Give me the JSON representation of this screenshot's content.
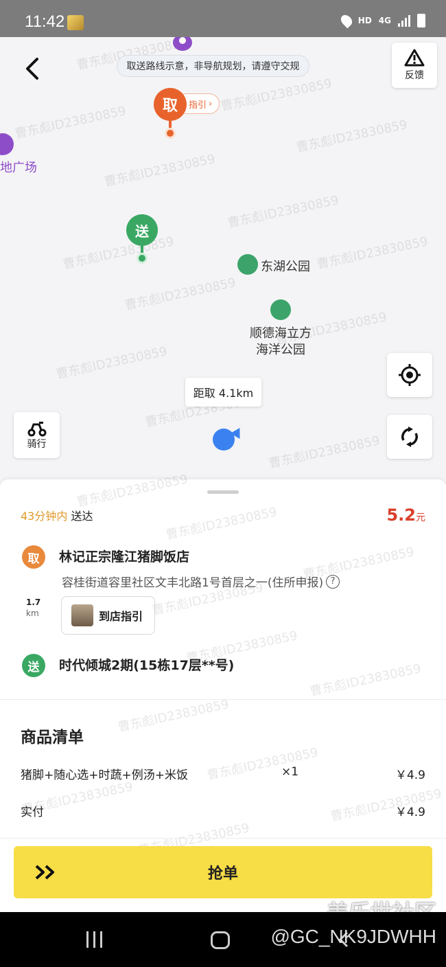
{
  "status_bar": {
    "time": "11:42",
    "network": "HD",
    "net_type": "4G"
  },
  "map": {
    "notice": "取送路线示意，非导航规划，请遵守交规",
    "feedback_label": "反馈",
    "pickup_marker": "取",
    "pickup_guide": "指引",
    "deliver_marker": "送",
    "poi_partial": "地广场",
    "poi_park": "东湖公园",
    "poi_ocean": "顺德海立方\n海洋公园",
    "distance_bubble": "距取 4.1km",
    "ride_label": "骑行"
  },
  "order": {
    "eta_time": "43分钟内",
    "eta_suffix": "送达",
    "price": "5.2",
    "price_unit": "元",
    "pickup_badge": "取",
    "shop_name": "林记正宗隆江猪脚饭店",
    "shop_address": "容桂街道容里社区文丰北路1号首层之一(住所申报)",
    "distance_value": "1.7",
    "distance_unit": "km",
    "store_guide_label": "到店指引",
    "drop_badge": "送",
    "drop_address": "时代倾城2期(15栋17层**号)",
    "goods_title": "商品清单",
    "items": [
      {
        "name": "猪脚+随心选+时蔬+例汤+米饭",
        "qty": "×1",
        "price": "￥4.9"
      }
    ],
    "paid_label": "实付",
    "paid_value": "￥4.9",
    "grab_label": "抢单"
  },
  "watermarks": {
    "text": "曹东彪ID23830859",
    "community": "盖乐世社区",
    "handle": "@GC_NK9JDWHH"
  },
  "colors": {
    "accent_yellow": "#f7dd46",
    "pickup_orange": "#e8632c",
    "deliver_green": "#3aa863",
    "price_red": "#d9402b",
    "eta_orange": "#e09a2c"
  }
}
